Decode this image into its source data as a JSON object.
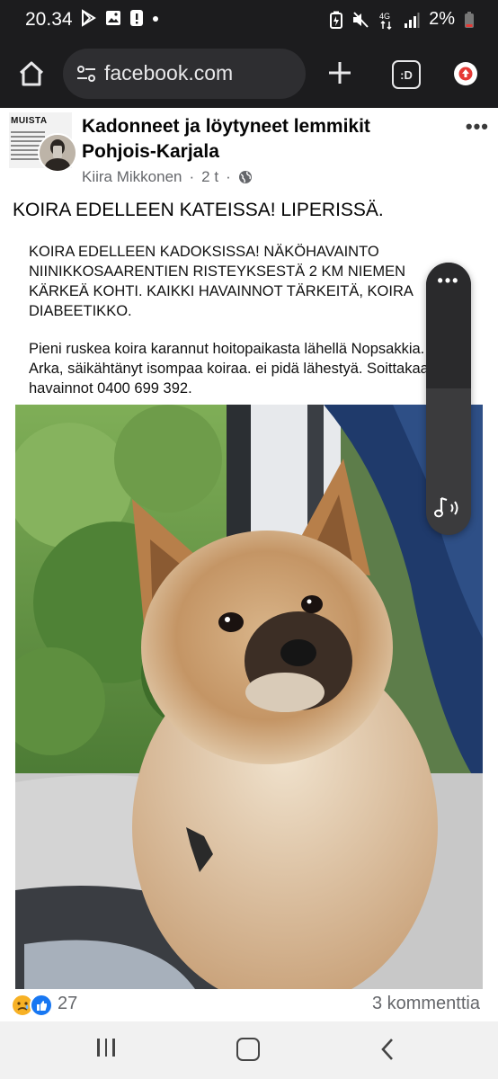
{
  "status_bar": {
    "time": "20.34",
    "network": "4G",
    "battery": "2%",
    "left_icons": [
      "play-store-icon",
      "gallery-icon",
      "alert-icon",
      "dot-icon"
    ],
    "right_icons": [
      "battery-saver-icon",
      "mute-icon",
      "network-4g-icon",
      "signal-icon",
      "battery-icon"
    ]
  },
  "browser": {
    "url": "facebook.com",
    "tab_label": ":D",
    "icons": [
      "home-icon",
      "site-settings-icon",
      "new-tab-icon",
      "tab-switcher-icon",
      "update-icon"
    ]
  },
  "post": {
    "group_name": "Kadonneet ja löytyneet lemmikit Pohjois-Karjala",
    "group_avatar_text": "MUISTA",
    "author": "Kiira Mikkonen",
    "time": "2 t",
    "privacy_icon": "globe-icon",
    "text": "KOIRA EDELLEEN KATEISSA! LIPERISSÄ.",
    "card": {
      "paragraph1": "KOIRA EDELLEEN KADOKSISSA! NÄKÖHAVAINTO NIINIKKOSAARENTIEN RISTEYKSESTÄ 2 KM NIEMEN KÄRKEÄ KOHTI. KAIKKI HAVAINNOT TÄRKEITÄ, KOIRA DIABEETIKKO.",
      "paragraph2": "Pieni ruskea koira karannut hoitopaikasta lähellä Nopsakkia. Arka, säikähtänyt isompaa koiraa. ei pidä lähestyä. Soittakaa havainnot 0400 699 392."
    },
    "reactions": {
      "count": "27",
      "types": [
        "sad",
        "like"
      ]
    },
    "comments": "3 kommenttia"
  },
  "volume_panel": {
    "icons": [
      "more-options-icon",
      "media-volume-icon"
    ]
  },
  "nav": {
    "icons": [
      "recents-icon",
      "home-icon",
      "back-icon"
    ]
  },
  "colors": {
    "status_bg": "#1c1c1e",
    "url_pill": "#2e2e31",
    "facebook_blue": "#1877f2",
    "reaction_yellow": "#f7b125",
    "update_red": "#e53935"
  }
}
